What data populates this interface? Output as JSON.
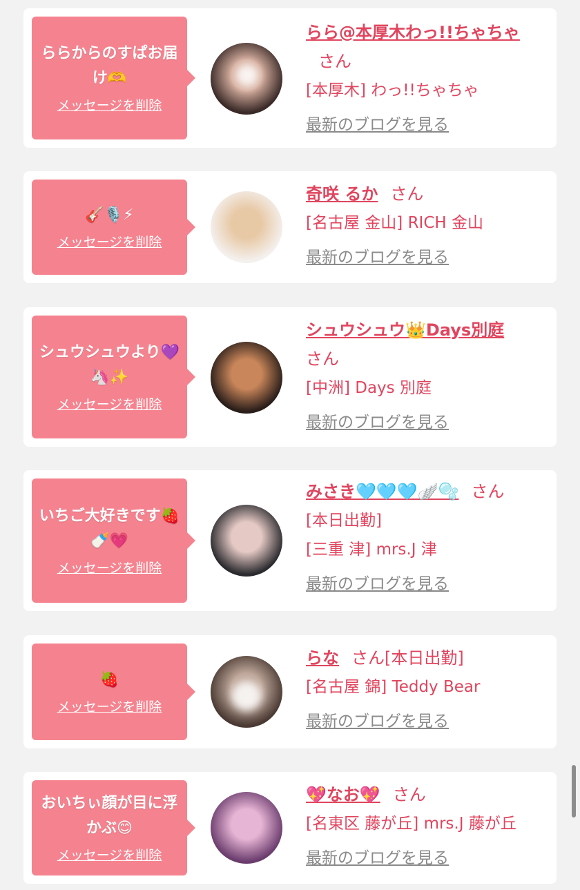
{
  "delete_label": "メッセージを削除",
  "san_label": "さん",
  "blog_label": "最新のブログを見る",
  "colors": {
    "bubble": "#f5838f",
    "accent": "#e0455e",
    "link_gray": "#8a8a8a",
    "page_bg": "#f2f2f2"
  },
  "messages": [
    {
      "message": "ららからのすぱお届け🫶",
      "name": "らら@本厚木わっ!!ちゃちゃ",
      "shop": "[本厚木] わっ!!ちゃちゃ",
      "extra": "",
      "avatar_colors": [
        "#3a2a28",
        "#d8b0a0"
      ]
    },
    {
      "message": "🎸🎙️⚡",
      "name": "奇咲 るか",
      "shop": "[名古屋 金山] RICH 金山",
      "extra": "",
      "avatar_colors": [
        "#f4f0ee",
        "#e8c9a6"
      ]
    },
    {
      "message": "シュウシュウより💜🦄✨",
      "name": "シュウシュウ👑Days別庭",
      "shop": "[中洲] Days 別庭",
      "extra": "",
      "avatar_colors": [
        "#2a1e1a",
        "#c9865a"
      ]
    },
    {
      "message": "いちご大好きです🍓🍼💗",
      "name": "みさき🩵🩵🩵🪽🫧",
      "shop": "[三重 津] mrs.J 津",
      "extra": "[本日出勤]",
      "avatar_colors": [
        "#2b2b2f",
        "#e5c9c4"
      ]
    },
    {
      "message": "🍓",
      "name": "らな",
      "shop": "[名古屋 錦] Teddy Bear",
      "extra": "[本日出勤]",
      "avatar_colors": [
        "#4a3a33",
        "#bfa79a"
      ]
    },
    {
      "message": "おいちぃ顔が目に浮かぶ😊",
      "name": "💖なお💖",
      "shop": "[名東区 藤が丘] mrs.J 藤が丘",
      "extra": "",
      "avatar_colors": [
        "#6b3d6e",
        "#e6b4d4"
      ]
    }
  ]
}
